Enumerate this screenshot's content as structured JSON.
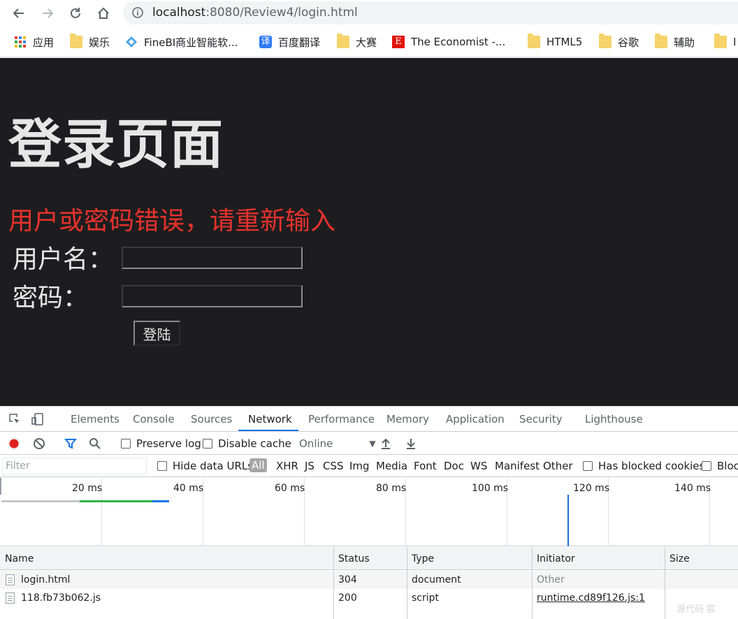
{
  "browser": {
    "url_host": "localhost",
    "url_path": ":8080/Review4/login.html",
    "bookmarks": [
      "应用",
      "娱乐",
      "FineBI商业智能软...",
      "百度翻译",
      "大赛",
      "The Economist -...",
      "HTML5",
      "谷歌",
      "辅助",
      "I"
    ],
    "bookmark_icons": [
      "apps-grid-icon",
      "folder-icon",
      "finebi-icon",
      "baidu-translate-icon",
      "folder-icon",
      "economist-icon",
      "folder-icon",
      "folder-icon",
      "folder-icon",
      "folder-icon"
    ],
    "baidu_icon_char": "译",
    "economist_icon_char": "E"
  },
  "page": {
    "title": "登录页面",
    "error": "用户或密码错误，请重新输入",
    "username_label": "用户名：",
    "password_label": "密码：",
    "username_value": "",
    "password_value": "",
    "login_button": "登陆",
    "background": "#1d1d1f",
    "error_color": "#e8322c"
  },
  "devtools": {
    "tabs": [
      "Elements",
      "Console",
      "Sources",
      "Network",
      "Performance",
      "Memory",
      "Application",
      "Security",
      "Lighthouse"
    ],
    "active_tab": "Network",
    "toolbar": {
      "preserve_log": "Preserve log",
      "disable_cache": "Disable cache",
      "throttling": "Online"
    },
    "filter": {
      "placeholder": "Filter",
      "hide_data_urls": "Hide data URLs",
      "types": [
        "All",
        "XHR",
        "JS",
        "CSS",
        "Img",
        "Media",
        "Font",
        "Doc",
        "WS",
        "Manifest",
        "Other"
      ],
      "has_blocked_cookies": "Has blocked cookies",
      "blocked_requests": "Block"
    },
    "timeline_ticks": [
      "20 ms",
      "40 ms",
      "60 ms",
      "80 ms",
      "100 ms",
      "120 ms",
      "140 ms"
    ],
    "columns": [
      "Name",
      "Status",
      "Type",
      "Initiator",
      "Size"
    ],
    "rows": [
      {
        "name": "login.html",
        "status": "304",
        "type": "document",
        "initiator": "Other",
        "size": ""
      },
      {
        "name": "118.fb73b062.js",
        "status": "200",
        "type": "script",
        "initiator": "runtime.cd89f126.js:1",
        "size": ""
      }
    ],
    "watermark": "源代码 宸"
  }
}
